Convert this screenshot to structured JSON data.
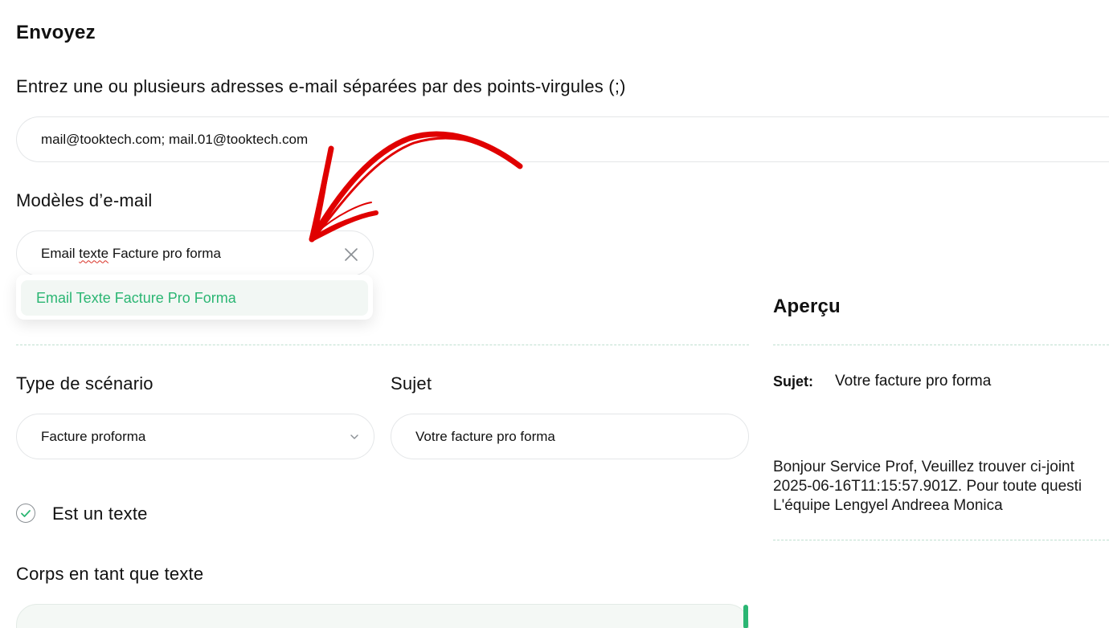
{
  "form": {
    "title": "Envoyez",
    "emails_label": "Entrez une ou plusieurs adresses e-mail séparées par des points-virgules (;)",
    "emails_value": "mail@tooktech.com; mail.01@tooktech.com",
    "templates_label": "Modèles d’e-mail",
    "template_value_prefix": "Email ",
    "template_value_misspelled": "texte",
    "template_value_suffix": " Facture pro forma",
    "template_clear_icon": "close-icon",
    "template_options": [
      "Email Texte Facture Pro Forma"
    ],
    "scenario_label": "Type de scénario",
    "scenario_value": "Facture proforma",
    "subject_label": "Sujet",
    "subject_value": "Votre facture pro forma",
    "is_text_label": "Est un texte",
    "is_text_checked": true,
    "body_label": "Corps en tant que texte"
  },
  "preview": {
    "title": "Aperçu",
    "subject_key": "Sujet:",
    "subject_value": "Votre facture pro forma",
    "body_lines": [
      "Bonjour Service Prof, Veuillez trouver ci-joint",
      "2025-06-16T11:15:57.901Z. Pour toute questi",
      "L'équipe Lengyel Andreea Monica"
    ]
  },
  "colors": {
    "accent": "#2bb673",
    "annotation_arrow": "#e00000",
    "option_bg": "#f2f7f4"
  }
}
